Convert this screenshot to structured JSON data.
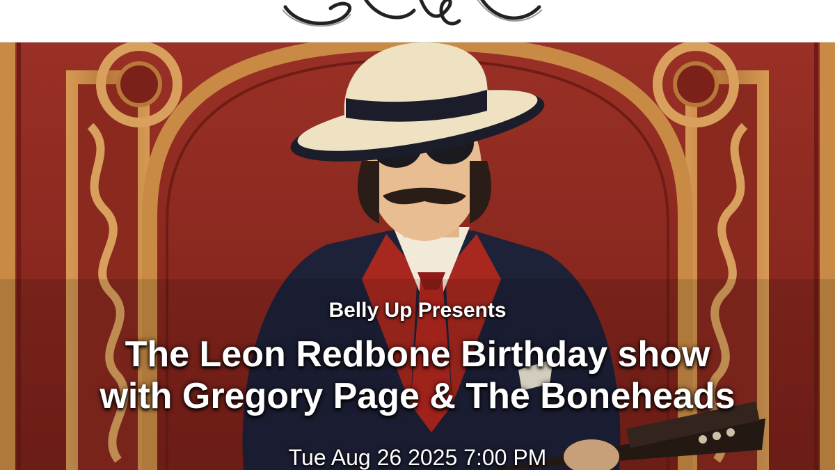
{
  "header": {
    "logo_label": "Belly Up"
  },
  "event": {
    "presenter": "Belly Up Presents",
    "title_line1": "The Leon Redbone Birthday show",
    "title_line2": "with Gregory Page & The Boneheads",
    "datetime": "Tue Aug 26 2025 7:00 PM"
  },
  "colors": {
    "poster_red": "#8e2a22",
    "poster_gold": "#c98a45",
    "suit_navy": "#1e2238",
    "hat_cream": "#efe2c2",
    "tie_red": "#b5271f"
  }
}
